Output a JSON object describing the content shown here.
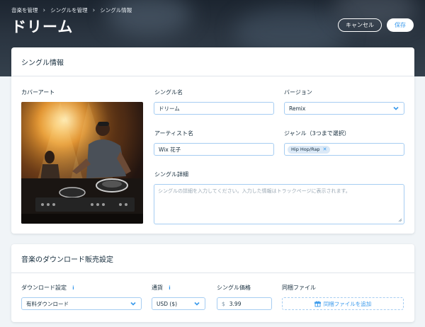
{
  "breadcrumb": [
    "音楽を管理",
    "シングルを管理",
    "シングル情報"
  ],
  "page_title": "ドリーム",
  "header_actions": {
    "cancel": "キャンセル",
    "save": "保存"
  },
  "single_info": {
    "section_title": "シングル情報",
    "cover_art_label": "カバーアート",
    "single_name_label": "シングル名",
    "single_name_value": "ドリーム",
    "version_label": "バージョン",
    "version_value": "Remix",
    "artist_label": "アーティスト名",
    "artist_value": "Wix 花子",
    "genre_label": "ジャンル（3つまで選択）",
    "genre_tags": [
      "Hip Hop/Rap"
    ],
    "details_label": "シングル詳細",
    "details_placeholder": "シングルの詳細を入力してください。入力した情報はトラックページに表示されます。"
  },
  "download_settings": {
    "section_title": "音楽のダウンロード販売設定",
    "download_label": "ダウンロード設定",
    "download_value": "有料ダウンロード",
    "currency_label": "通貨",
    "currency_value": "USD ($)",
    "price_label": "シングル価格",
    "price_symbol": "$",
    "price_value": "3.99",
    "attachment_label": "同梱ファイル",
    "attachment_button": "同梱ファイルを追加"
  },
  "colors": {
    "accent": "#3899ec",
    "text": "#162d3d",
    "page_bg": "#f0f4f7",
    "tag_bg": "#dbe9f7"
  }
}
